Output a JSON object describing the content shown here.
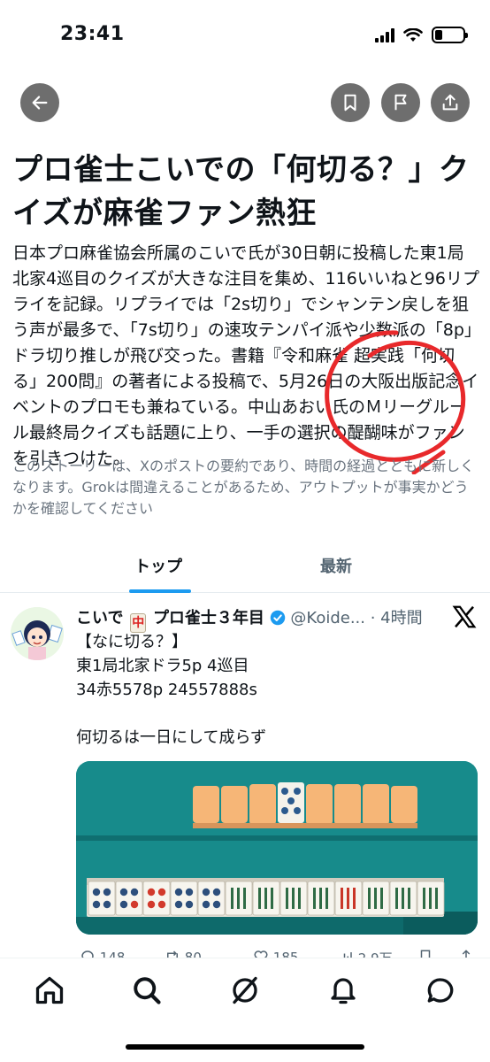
{
  "status_bar": {
    "time": "23:41"
  },
  "header": {
    "back_icon": "arrow-left-icon",
    "actions": [
      "bookmark-icon",
      "flag-icon",
      "share-icon"
    ]
  },
  "story": {
    "title": "プロ雀士こいでの「何切る？」クイズが麻雀ファン熱狂",
    "summary": "日本プロ麻雀協会所属のこいで氏が30日朝に投稿した東1局北家4巡目のクイズが大きな注目を集め、116いいねと96リプライを記録。リプライでは「2s切り」でシャンテン戻しを狙う声が最多で、「7s切り」の速攻テンパイ派や少数派の「8p」ドラ切り推しが飛び交った。書籍『令和麻雀 超実践「何切る」200問』の著者による投稿で、5月26日の大阪出版記念イベントのプロモも兼ねている。中山あおい氏のＭリーグルール最終局クイズも話題に上り、一手の選択の醍醐味がファンを引きつけた。",
    "disclaimer": "このストーリーは、Xのポストの要約であり、時間の経過とともに新しくなります。Grokは間違えることがあるため、アウトプットが事実かどうかを確認してください"
  },
  "tabs": [
    {
      "label": "トップ",
      "active": true
    },
    {
      "label": "最新",
      "active": false
    }
  ],
  "post": {
    "name_prefix": "こいで",
    "name_suffix": "プロ雀士３年目",
    "handle": "@Koide...",
    "time": "· 4時間",
    "body": "【なに切る？】\n東1局北家ドラ5p 4巡目\n34赤5578p 24557888s\n\n何切るは一日にして成らず",
    "stats": {
      "replies": "148",
      "reposts": "80",
      "likes": "185",
      "views": "2.9万"
    }
  },
  "colors": {
    "accent": "#1d9bf0",
    "table_felt": "#178b8b",
    "annotation": "#e8292b"
  }
}
